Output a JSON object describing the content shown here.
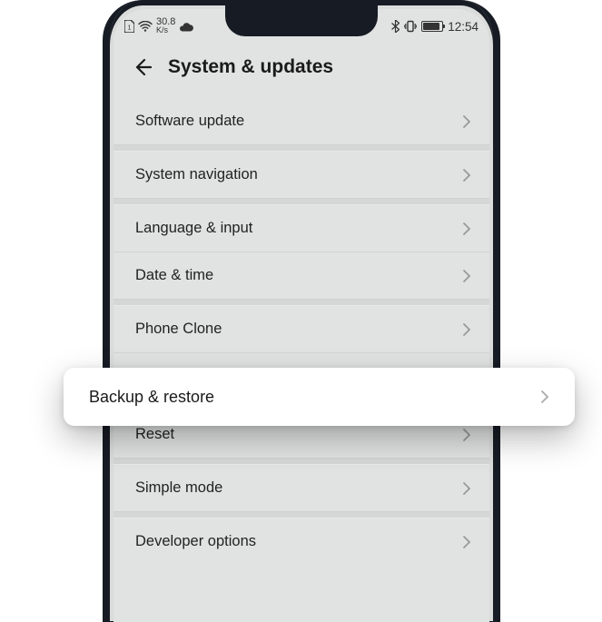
{
  "status": {
    "speed_value": "30.8",
    "speed_unit": "K/s",
    "time": "12:54"
  },
  "header": {
    "title": "System & updates"
  },
  "items": {
    "software_update": "Software update",
    "system_navigation": "System navigation",
    "language_input": "Language & input",
    "date_time": "Date & time",
    "phone_clone": "Phone Clone",
    "backup_restore": "Backup & restore",
    "reset": "Reset",
    "simple_mode": "Simple mode",
    "developer_options": "Developer options"
  }
}
